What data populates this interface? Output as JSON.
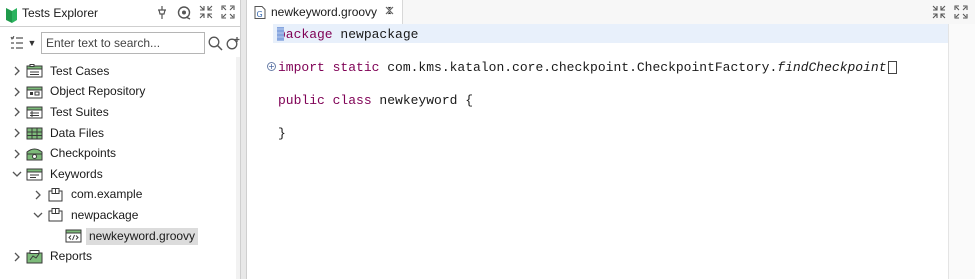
{
  "tests_explorer": {
    "tab_title": "Tests Explorer",
    "icons": [
      "pin-icon",
      "refresh-icon",
      "collapse-icon",
      "maximize-icon"
    ],
    "search_placeholder": "Enter text to search...",
    "tree": [
      {
        "label": "Test Cases",
        "icon": "test-cases-icon",
        "expanded": false,
        "level": 0
      },
      {
        "label": "Object Repository",
        "icon": "object-repository-icon",
        "expanded": false,
        "level": 0
      },
      {
        "label": "Test Suites",
        "icon": "test-suites-icon",
        "expanded": false,
        "level": 0
      },
      {
        "label": "Data Files",
        "icon": "data-files-icon",
        "expanded": false,
        "level": 0
      },
      {
        "label": "Checkpoints",
        "icon": "checkpoints-icon",
        "expanded": false,
        "level": 0
      },
      {
        "label": "Keywords",
        "icon": "keywords-icon",
        "expanded": true,
        "level": 0
      },
      {
        "label": "com.example",
        "icon": "package-icon",
        "expanded": false,
        "level": 1
      },
      {
        "label": "newpackage",
        "icon": "package-icon",
        "expanded": true,
        "level": 1
      },
      {
        "label": "newkeyword.groovy",
        "icon": "groovy-file-icon",
        "expanded": null,
        "level": 2,
        "selected": true
      },
      {
        "label": "Reports",
        "icon": "reports-icon",
        "expanded": false,
        "level": 0
      }
    ]
  },
  "editor": {
    "tab_title": "newkeyword.groovy",
    "code": {
      "line1_kw": "package",
      "line1_rest": " newpackage",
      "line2_kw1": "import",
      "line2_kw2": " static",
      "line2_rest": " com.kms.katalon.core.checkpoint.CheckpointFactory.",
      "line2_italic": "findCheckpoint",
      "line3_kw1": "public",
      "line3_kw2": " class",
      "line3_rest": " newkeyword {",
      "line4": "}"
    }
  },
  "colors": {
    "keyword": "#7f0055",
    "selection": "#dcdcdc",
    "current_line": "#e8f0fb"
  }
}
